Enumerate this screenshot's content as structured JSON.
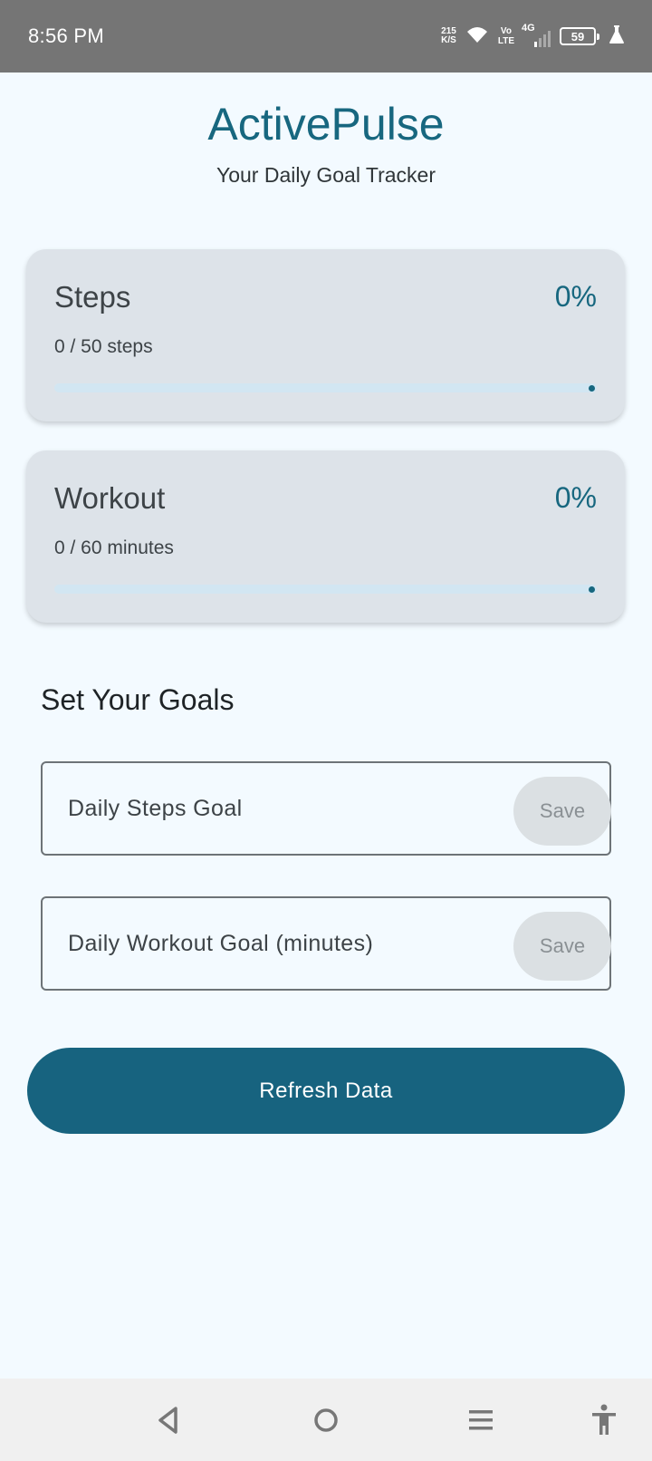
{
  "status_bar": {
    "time": "8:56 PM",
    "net_speed_value": "215",
    "net_speed_unit": "K/S",
    "volte_top": "Vo",
    "volte_bottom": "LTE",
    "network_type": "4G",
    "battery_level": "59",
    "icons": [
      "wifi-icon",
      "signal-icon",
      "battery-icon",
      "beaker-icon"
    ]
  },
  "header": {
    "title": "ActivePulse",
    "subtitle": "Your Daily Goal Tracker"
  },
  "cards": {
    "steps": {
      "title": "Steps",
      "percent": "0%",
      "detail": "0 / 50 steps",
      "progress_fraction": 0
    },
    "workout": {
      "title": "Workout",
      "percent": "0%",
      "detail": "0 / 60 minutes",
      "progress_fraction": 0
    }
  },
  "goals": {
    "section_title": "Set Your Goals",
    "steps_field": {
      "placeholder": "Daily Steps Goal",
      "value": "",
      "save_label": "Save"
    },
    "workout_field": {
      "placeholder": "Daily Workout Goal (minutes)",
      "value": "",
      "save_label": "Save"
    }
  },
  "actions": {
    "refresh_label": "Refresh Data"
  },
  "nav_bar": {
    "icons": [
      "back-icon",
      "home-icon",
      "recents-icon",
      "accessibility-icon"
    ]
  },
  "colors": {
    "primary": "#17677f",
    "background": "#f3faff",
    "card": "#dde3e9",
    "progress_track": "#d2e6f2",
    "status_bar": "#757575"
  }
}
